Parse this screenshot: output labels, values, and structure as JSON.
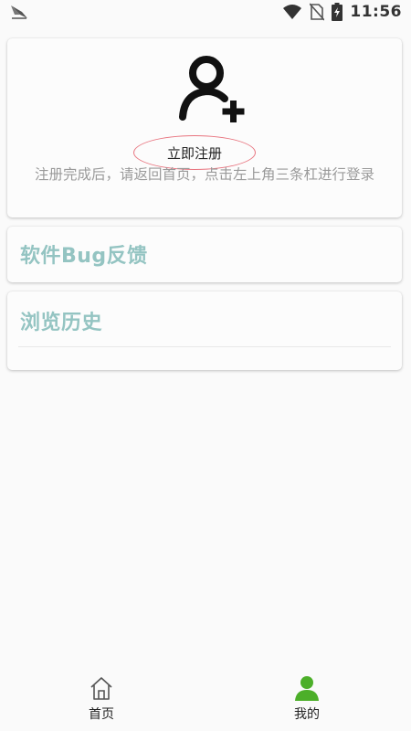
{
  "status_bar": {
    "time": "11:56"
  },
  "register_card": {
    "button_label": "立即注册",
    "hint": "注册完成后，请返回首页，点击左上角三条杠进行登录"
  },
  "menu": {
    "feedback_label": "软件Bug反馈",
    "history_label": "浏览历史"
  },
  "bottom_nav": {
    "home_label": "首页",
    "mine_label": "我的",
    "active_color": "#4caf29"
  },
  "colors": {
    "menu_text": "#94c4c2",
    "hint_text": "#9a9a9a",
    "register_outline": "#e8747f"
  }
}
